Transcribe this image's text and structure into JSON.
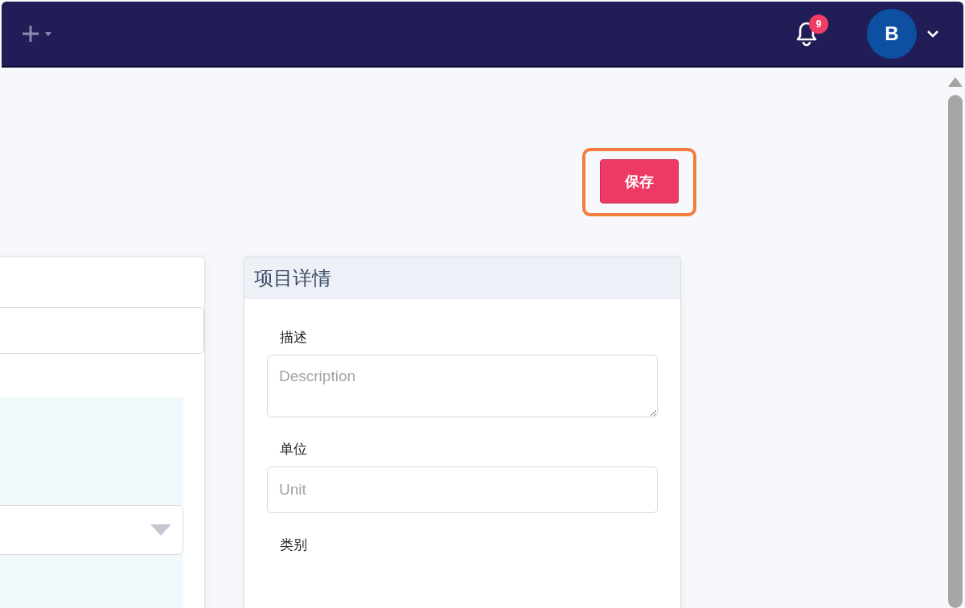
{
  "navbar": {
    "notifications": {
      "count": "9"
    },
    "avatar": {
      "initial": "B"
    }
  },
  "toolbar": {
    "save_button": {
      "label": "保存",
      "highlighted": true
    }
  },
  "left_card": {
    "fields": [
      {
        "kind": "input"
      }
    ],
    "panel": {
      "fields": [
        {
          "kind": "select"
        }
      ]
    }
  },
  "details_card": {
    "title": "项目详情",
    "fields": [
      {
        "kind": "textarea",
        "label": "描述",
        "placeholder": "Description"
      },
      {
        "kind": "input",
        "label": "单位",
        "placeholder": "Unit"
      },
      {
        "kind": "label",
        "label": "类别"
      }
    ]
  }
}
